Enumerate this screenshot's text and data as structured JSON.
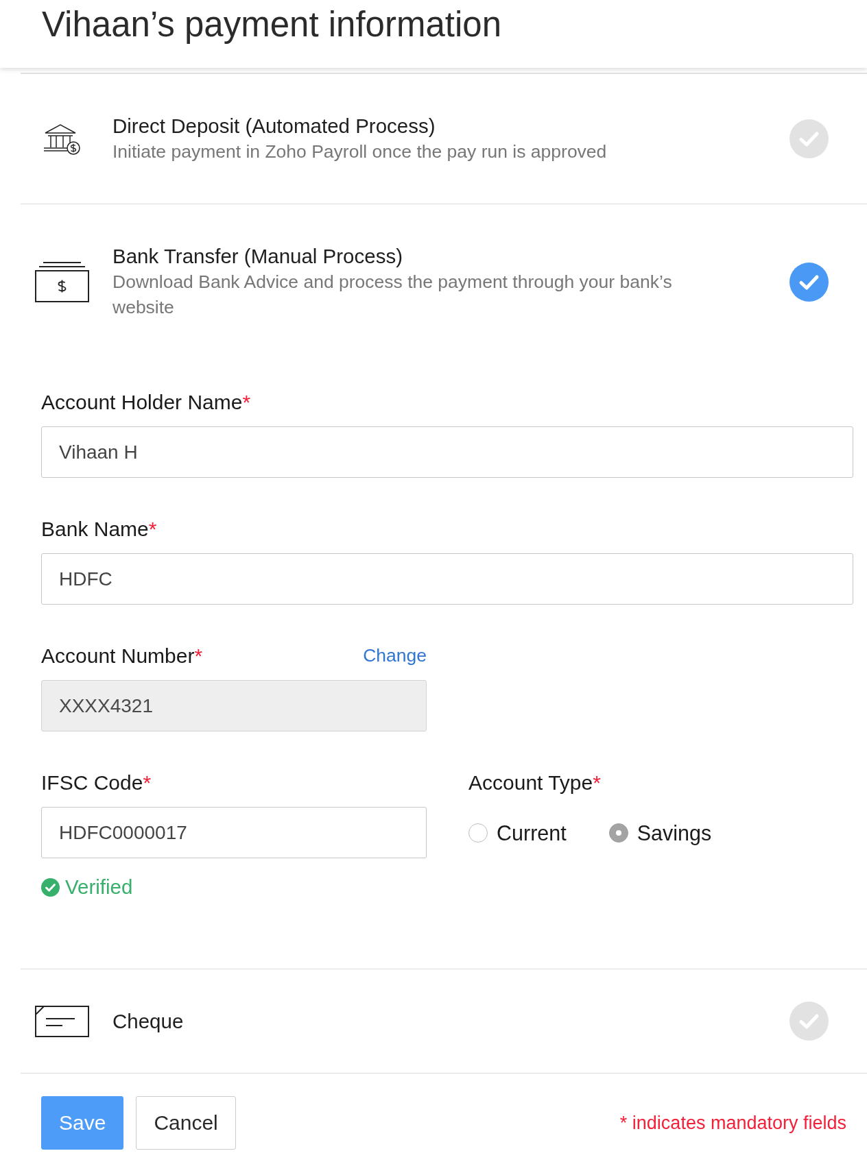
{
  "header": {
    "title": "Vihaan’s payment information"
  },
  "payment_methods": [
    {
      "kind": "direct_deposit",
      "title": "Direct Deposit (Automated Process)",
      "description": "Initiate payment in Zoho Payroll once the pay run is approved",
      "selected": false
    },
    {
      "kind": "bank_transfer",
      "title": "Bank Transfer (Manual Process)",
      "description": "Download Bank Advice and process the payment through your bank’s website",
      "selected": true,
      "form": {
        "account_holder_name": {
          "label": "Account Holder Name",
          "required_mark": "*",
          "value": "Vihaan H",
          "disabled": false
        },
        "bank_name": {
          "label": "Bank Name",
          "required_mark": "*",
          "value": "HDFC",
          "disabled": false
        },
        "account_number": {
          "label": "Account Number",
          "required_mark": "*",
          "value": "XXXX4321",
          "disabled": true,
          "action": "Change"
        },
        "ifsc_code": {
          "label": "IFSC Code",
          "required_mark": "*",
          "value": "HDFC0000017",
          "disabled": false,
          "status": "Verified"
        },
        "account_type": {
          "label": "Account Type",
          "required_mark": "*",
          "options": [
            {
              "label": "Current",
              "selected": false
            },
            {
              "label": "Savings",
              "selected": true
            }
          ]
        }
      }
    },
    {
      "kind": "cheque",
      "title": "Cheque",
      "selected": false
    }
  ],
  "footer": {
    "buttons": [
      {
        "label": "Save",
        "kind": "primary"
      },
      {
        "label": "Cancel",
        "kind": "secondary"
      }
    ],
    "note": "* indicates mandatory fields"
  }
}
